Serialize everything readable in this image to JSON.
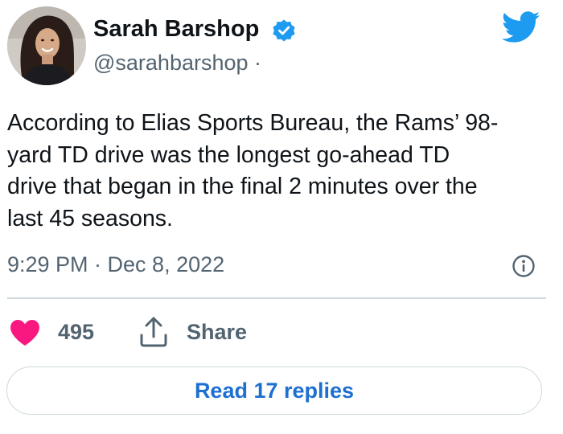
{
  "author": {
    "display_name": "Sarah Barshop",
    "handle": "@sarahbarshop",
    "handle_separator": "·",
    "verified": true
  },
  "icons": {
    "avatar": "profile-photo",
    "verified": "verified-badge-icon",
    "brand": "twitter-bird-icon",
    "info": "info-icon",
    "like": "heart-icon",
    "share": "share-icon"
  },
  "tweet": {
    "text_lines": [
      "According to Elias Sports Bureau, the Rams’ 98-",
      "yard TD drive was the longest go-ahead TD",
      "drive that began in the final 2 minutes over the",
      "last 45 seasons."
    ],
    "timestamp": "9:29 PM · Dec 8, 2022"
  },
  "actions": {
    "like_count": "495",
    "share_label": "Share",
    "read_replies_label": "Read 17 replies"
  },
  "colors": {
    "text_primary": "#0f1419",
    "text_secondary": "#536471",
    "verified_blue": "#1d9bf0",
    "twitter_blue": "#1d9bf0",
    "like_pink": "#f91880",
    "link_blue": "#1d6fd0",
    "divider": "#cfd9de"
  }
}
